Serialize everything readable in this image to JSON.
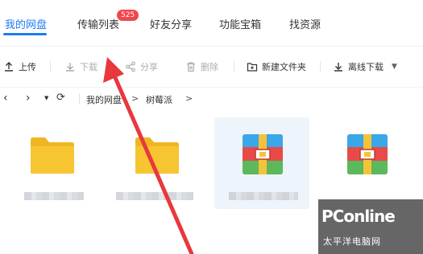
{
  "tabs": [
    {
      "label": "我的网盘",
      "active": true
    },
    {
      "label": "传输列表",
      "badge": "525"
    },
    {
      "label": "好友分享"
    },
    {
      "label": "功能宝箱"
    },
    {
      "label": "找资源"
    }
  ],
  "toolbar": {
    "upload": "上传",
    "download": "下载",
    "share": "分享",
    "delete": "删除",
    "new_folder": "新建文件夹",
    "offline_download": "离线下载"
  },
  "path": {
    "crumbs": [
      "我的网盘",
      "树莓派"
    ],
    "separator": ">"
  },
  "files": [
    {
      "type": "folder",
      "icon": "folder-icon"
    },
    {
      "type": "folder",
      "icon": "folder-icon"
    },
    {
      "type": "archive",
      "icon": "archive-icon"
    },
    {
      "type": "archive",
      "icon": "archive-icon"
    }
  ],
  "watermark": {
    "brand": "PConline",
    "sub": "太平洋电脑网"
  },
  "colors": {
    "accent": "#1e7cf2",
    "badge": "#f2464b",
    "folder": "#f7c531",
    "annotation_arrow": "#e8383d"
  }
}
